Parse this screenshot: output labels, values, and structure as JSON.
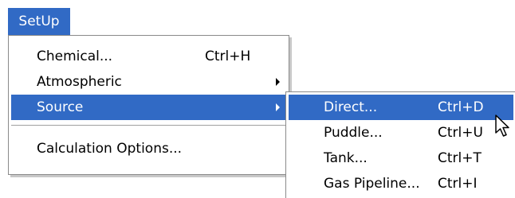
{
  "menubar": {
    "setup_label": "SetUp"
  },
  "setup_menu": {
    "items": [
      {
        "label": "Chemical...",
        "shortcut": "Ctrl+H"
      },
      {
        "label": "Atmospheric",
        "shortcut": ""
      },
      {
        "label": "Source",
        "shortcut": ""
      },
      {
        "label": "Calculation Options...",
        "shortcut": ""
      }
    ]
  },
  "source_submenu": {
    "items": [
      {
        "label": "Direct...",
        "shortcut": "Ctrl+D"
      },
      {
        "label": "Puddle...",
        "shortcut": "Ctrl+U"
      },
      {
        "label": "Tank...",
        "shortcut": "Ctrl+T"
      },
      {
        "label": "Gas Pipeline...",
        "shortcut": "Ctrl+I"
      }
    ]
  },
  "colors": {
    "highlight": "#316ac5",
    "highlight_text": "#ffffff"
  },
  "icons": {
    "submenu_arrow": "triangle-right",
    "cursor": "mouse-pointer-arrow"
  }
}
